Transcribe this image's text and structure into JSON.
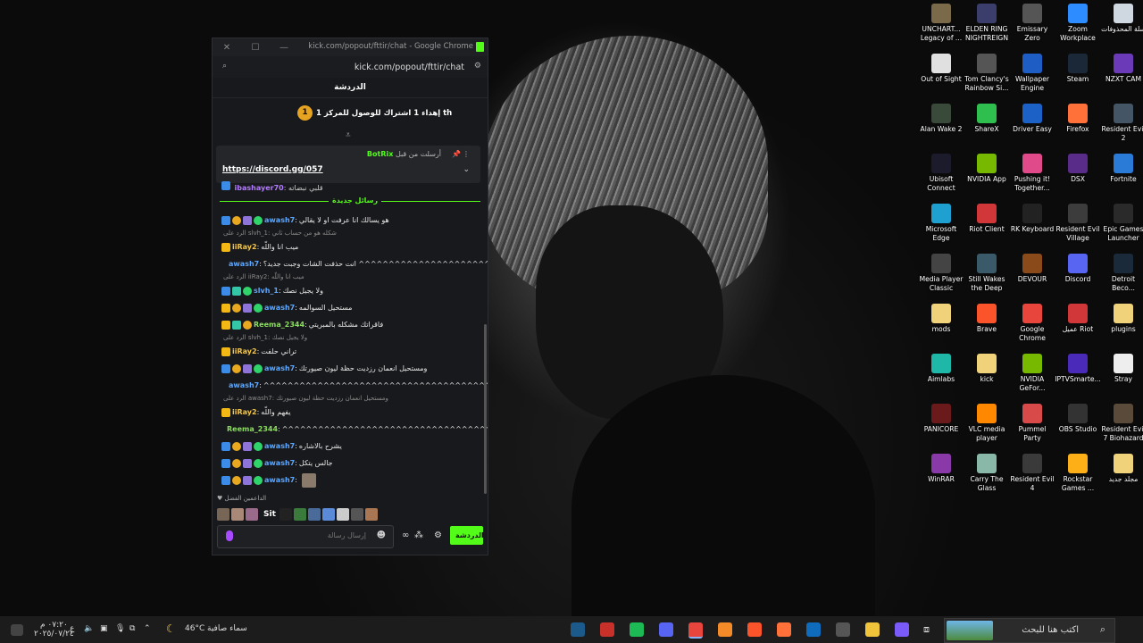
{
  "window": {
    "title": "kick.com/popout/fttir/chat - Google Chrome",
    "url": "kick.com/popout/fttir/chat"
  },
  "chat": {
    "header": "الدردشة",
    "goal_rank": "1",
    "goal_text": "إهداء 1 اشتراك للوصول للمركز 1 th",
    "pinned": {
      "user": "BotRix",
      "sent_by": "أرسلت من قبل",
      "link": "https://discord.gg/057"
    },
    "partial_line": {
      "user": "ibashayer70",
      "text": "قلبي نبضاته"
    },
    "new_messages_label": "رسائل جديدة",
    "messages": [
      {
        "reply": "",
        "user": "awash7",
        "text": "هو يسالك انا عرفت او لا يقالي",
        "color": "bl",
        "badges": [
          "bl",
          "go",
          "pu",
          "gr"
        ]
      },
      {
        "reply": "الرد على slvh_1: شكله هو من حساب ثاني",
        "user": "iiRay2",
        "text": "ميب انا واللّه",
        "color": "ye",
        "badges": [
          "cr"
        ]
      },
      {
        "reply": "",
        "user": "awash7",
        "text": "انت حذفت الشات وجبت جديد؟ ^^^^^^^^^^^^^^^^^^^^^^^^^^^^^^^^^^^",
        "color": "bl",
        "badges": [
          "bl",
          "go",
          "pu",
          "gr"
        ]
      },
      {
        "reply": "الرد على iiRay2: ميب انا واللّه",
        "user": "slvh_1",
        "text": "ولا يجيل نصك",
        "color": "bl",
        "badges": [
          "bl",
          "ge",
          "gr"
        ]
      },
      {
        "reply": "",
        "user": "awash7",
        "text": "مستحيل السوالمه",
        "color": "bl",
        "badges": [
          "cr",
          "go",
          "pu",
          "gr"
        ]
      },
      {
        "reply": "",
        "user": "Reema_2344",
        "text": "فاقراتك مشكله بالمبريتي",
        "color": "gr",
        "badges": [
          "cr",
          "ge",
          "go"
        ]
      },
      {
        "reply": "الرد على slvh_1: ولا يجيل نصك",
        "user": "iiRay2",
        "text": "تراني حلفت",
        "color": "ye",
        "badges": [
          "cr"
        ]
      },
      {
        "reply": "",
        "user": "awash7",
        "text": "ومستحيل انعمان رزديت حظة ليون صيورتك",
        "color": "bl",
        "badges": [
          "bl",
          "go",
          "pu",
          "gr"
        ]
      },
      {
        "reply": "",
        "user": "awash7",
        "text": "^^^^^^^^^^^^^^^^^^^^^^^^^^^^^^^^^^^^^^^",
        "color": "bl",
        "badges": [
          "bl",
          "go",
          "pu",
          "gr"
        ]
      },
      {
        "reply": "الرد على awash7: ومستحيل انعمان رزديت حظة ليون صيورتك",
        "user": "iiRay2",
        "text": "يفهم واللّه",
        "color": "ye",
        "badges": [
          "cr"
        ]
      },
      {
        "reply": "",
        "user": "Reema_2344",
        "text": "^^^^^^^^^^^^^^^^^^^^^^^^^^^^^^^^^^^^^^^^",
        "color": "gr",
        "badges": [
          "cr",
          "ge",
          "go"
        ]
      },
      {
        "reply": "",
        "user": "awash7",
        "text": "يشرح بالاشاره",
        "color": "bl",
        "badges": [
          "bl",
          "go",
          "pu",
          "gr"
        ]
      },
      {
        "reply": "",
        "user": "awash7",
        "text": "جالس يتكل",
        "color": "bl",
        "badges": [
          "bl",
          "go",
          "pu",
          "gr"
        ]
      },
      {
        "reply": "",
        "user": "awash7",
        "text": "",
        "color": "bl",
        "badges": [
          "bl",
          "go",
          "pu",
          "gr"
        ],
        "emote": true
      }
    ],
    "top_supporters_label": "الداعمين الفضل",
    "sit_text": "Sit",
    "input_placeholder": "إرسال رسالة",
    "chat_button": "الدردشة"
  },
  "desktop_icons": [
    {
      "label": "UNCHART... Legacy of ...",
      "color": "#7a6a4a"
    },
    {
      "label": "ELDEN RING NIGHTREIGN",
      "color": "#3b3e6a"
    },
    {
      "label": "Emissary Zero",
      "color": "#555"
    },
    {
      "label": "Zoom Workplace",
      "color": "#2d8cff"
    },
    {
      "label": "سلة المحذوفات",
      "color": "#cfd8e0"
    },
    {
      "label": "Out of Sight",
      "color": "#e0e0e0"
    },
    {
      "label": "Tom Clancy's Rainbow Si...",
      "color": "#555"
    },
    {
      "label": "Wallpaper Engine",
      "color": "#1e5ec4"
    },
    {
      "label": "Steam",
      "color": "#1b2838"
    },
    {
      "label": "NZXT CAM",
      "color": "#6a3ab8"
    },
    {
      "label": "Alan Wake 2",
      "color": "#3a4a3a"
    },
    {
      "label": "ShareX",
      "color": "#2fbf4f"
    },
    {
      "label": "Driver Easy",
      "color": "#1c62c6"
    },
    {
      "label": "Firefox",
      "color": "#ff7139"
    },
    {
      "label": "Resident Evil 2",
      "color": "#445566"
    },
    {
      "label": "Ubisoft Connect",
      "color": "#1b1b2b"
    },
    {
      "label": "NVIDIA App",
      "color": "#76b900"
    },
    {
      "label": "Pushing it! Together...",
      "color": "#e04a8a"
    },
    {
      "label": "DSX",
      "color": "#5a2c8a"
    },
    {
      "label": "Fortnite",
      "color": "#2a7ad8"
    },
    {
      "label": "Microsoft Edge",
      "color": "#1ea0d0"
    },
    {
      "label": "Riot Client",
      "color": "#d13639"
    },
    {
      "label": "RK Keyboard",
      "color": "#222"
    },
    {
      "label": "Resident Evil Village",
      "color": "#3c3c3c"
    },
    {
      "label": "Epic Games Launcher",
      "color": "#2a2a2a"
    },
    {
      "label": "Media Player Classic",
      "color": "#444"
    },
    {
      "label": "Still Wakes the Deep",
      "color": "#3a5a6a"
    },
    {
      "label": "DEVOUR",
      "color": "#8a4a1a"
    },
    {
      "label": "Discord",
      "color": "#5865f2"
    },
    {
      "label": "Detroit Beco...",
      "color": "#1a2a3a"
    },
    {
      "label": "mods",
      "color": "#f0d27a"
    },
    {
      "label": "Brave",
      "color": "#fb542b"
    },
    {
      "label": "Google Chrome",
      "color": "#e8453c"
    },
    {
      "label": "عميل Riot",
      "color": "#d13639"
    },
    {
      "label": "plugins",
      "color": "#f0d27a"
    },
    {
      "label": "Aimlabs",
      "color": "#1fb8a8"
    },
    {
      "label": "kick",
      "color": "#f0d27a"
    },
    {
      "label": "NVIDIA GeFor...",
      "color": "#76b900"
    },
    {
      "label": "IPTVSmarte...",
      "color": "#4a2ab8"
    },
    {
      "label": "Stray",
      "color": "#eee"
    },
    {
      "label": "PANICORE",
      "color": "#6a1a1a"
    },
    {
      "label": "VLC media player",
      "color": "#ff8800"
    },
    {
      "label": "Pummel Party",
      "color": "#d84a4a"
    },
    {
      "label": "OBS Studio",
      "color": "#333"
    },
    {
      "label": "Resident Evil 7 Biohazard",
      "color": "#5a4a3a"
    },
    {
      "label": "WinRAR",
      "color": "#8a3aa8"
    },
    {
      "label": "Carry The Glass",
      "color": "#8ab8a8"
    },
    {
      "label": "Resident Evil 4",
      "color": "#3a3a3a"
    },
    {
      "label": "Rockstar Games ...",
      "color": "#fcaf17"
    },
    {
      "label": "مجلد جديد",
      "color": "#f0d27a"
    }
  ],
  "taskbar": {
    "search_text": "اكتب هنا للبحث",
    "weather_temp": "46°C",
    "weather_text": "سماء صافية",
    "time": "٠٧:٢٠ م",
    "date": "٢٠٢٥/٠٧/٢٤",
    "lang": "ع",
    "icons": [
      "steam",
      "circle-app",
      "spotify",
      "discord",
      "chrome",
      "aimp",
      "brave",
      "firefox",
      "outlook",
      "store",
      "explorer",
      "copilot"
    ]
  }
}
